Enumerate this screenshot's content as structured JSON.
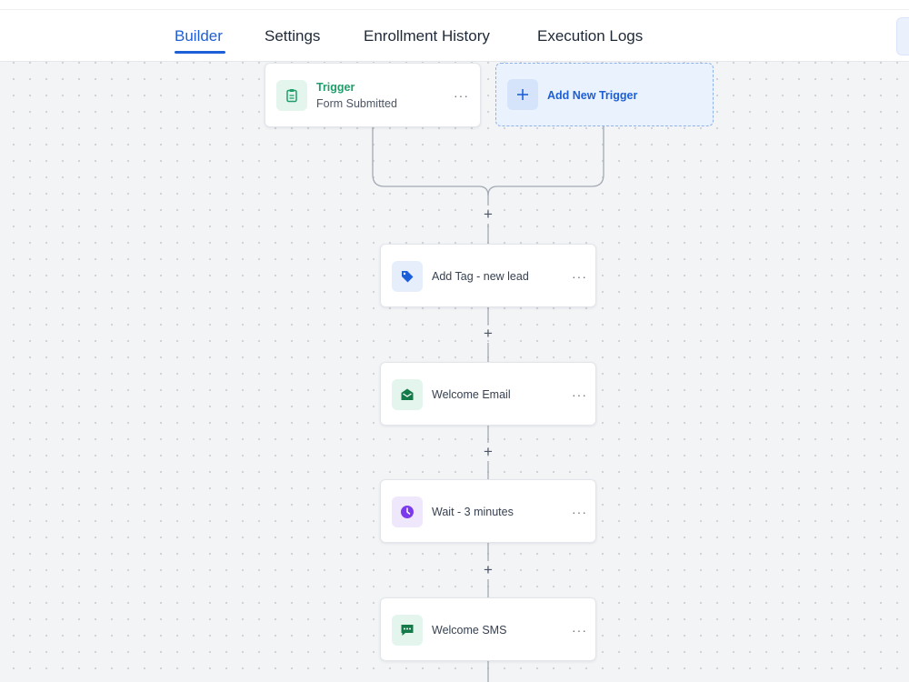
{
  "tabs": [
    {
      "label": "Builder",
      "active": true
    },
    {
      "label": "Settings",
      "active": false
    },
    {
      "label": "Enrollment History",
      "active": false
    },
    {
      "label": "Execution Logs",
      "active": false
    }
  ],
  "trigger": {
    "title": "Trigger",
    "subtitle": "Form Submitted",
    "icon": "clipboard-icon",
    "color": "#1f9d6b"
  },
  "add_trigger": {
    "label": "Add New Trigger",
    "icon": "plus-icon",
    "color": "#1d5fd6"
  },
  "actions": [
    {
      "label": "Add Tag - new lead",
      "icon": "tag-icon",
      "color": "#1d5fd6"
    },
    {
      "label": "Welcome Email",
      "icon": "envelope-open-icon",
      "color": "#157a4a"
    },
    {
      "label": "Wait - 3 minutes",
      "icon": "clock-icon",
      "color": "#7c3aed"
    },
    {
      "label": "Welcome SMS",
      "icon": "chat-message-icon",
      "color": "#157a4a"
    }
  ],
  "more_glyph": "···",
  "add_step_glyph": "+"
}
